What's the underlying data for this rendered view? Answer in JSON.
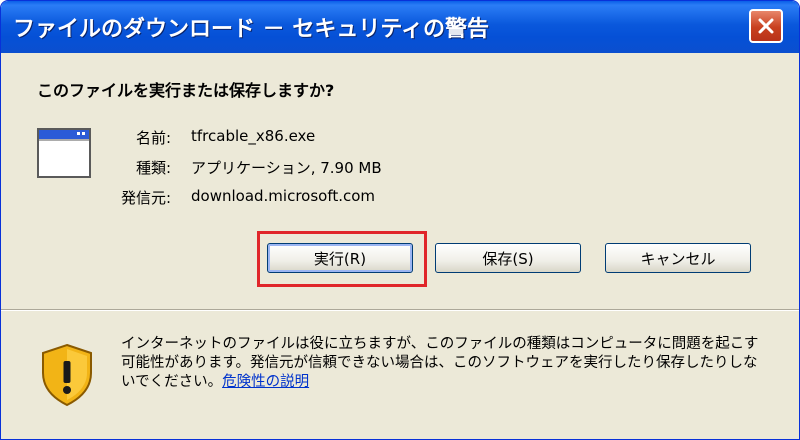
{
  "window": {
    "title": "ファイルのダウンロード － セキュリティの警告"
  },
  "question": "このファイルを実行または保存しますか?",
  "file_info": [
    {
      "label": "名前:",
      "value": "tfrcable_x86.exe"
    },
    {
      "label": "種類:",
      "value": "アプリケーション, 7.90 MB"
    },
    {
      "label": "発信元:",
      "value": "download.microsoft.com"
    }
  ],
  "buttons": {
    "run": "実行(R)",
    "save": "保存(S)",
    "cancel": "キャンセル"
  },
  "warning": {
    "text": "インターネットのファイルは役に立ちますが、このファイルの種類はコンピュータに問題を起こす可能性があります。発信元が信頼できない場合は、このソフトウェアを実行したり保存したりしないでください。",
    "link": "危険性の説明"
  },
  "colors": {
    "highlight_box": "#e0262a",
    "titlebar": "#0a58dc",
    "dialog_bg": "#ece9d8",
    "link": "#0033cc"
  },
  "icons": [
    "close-icon",
    "application-icon",
    "warning-shield-icon"
  ]
}
